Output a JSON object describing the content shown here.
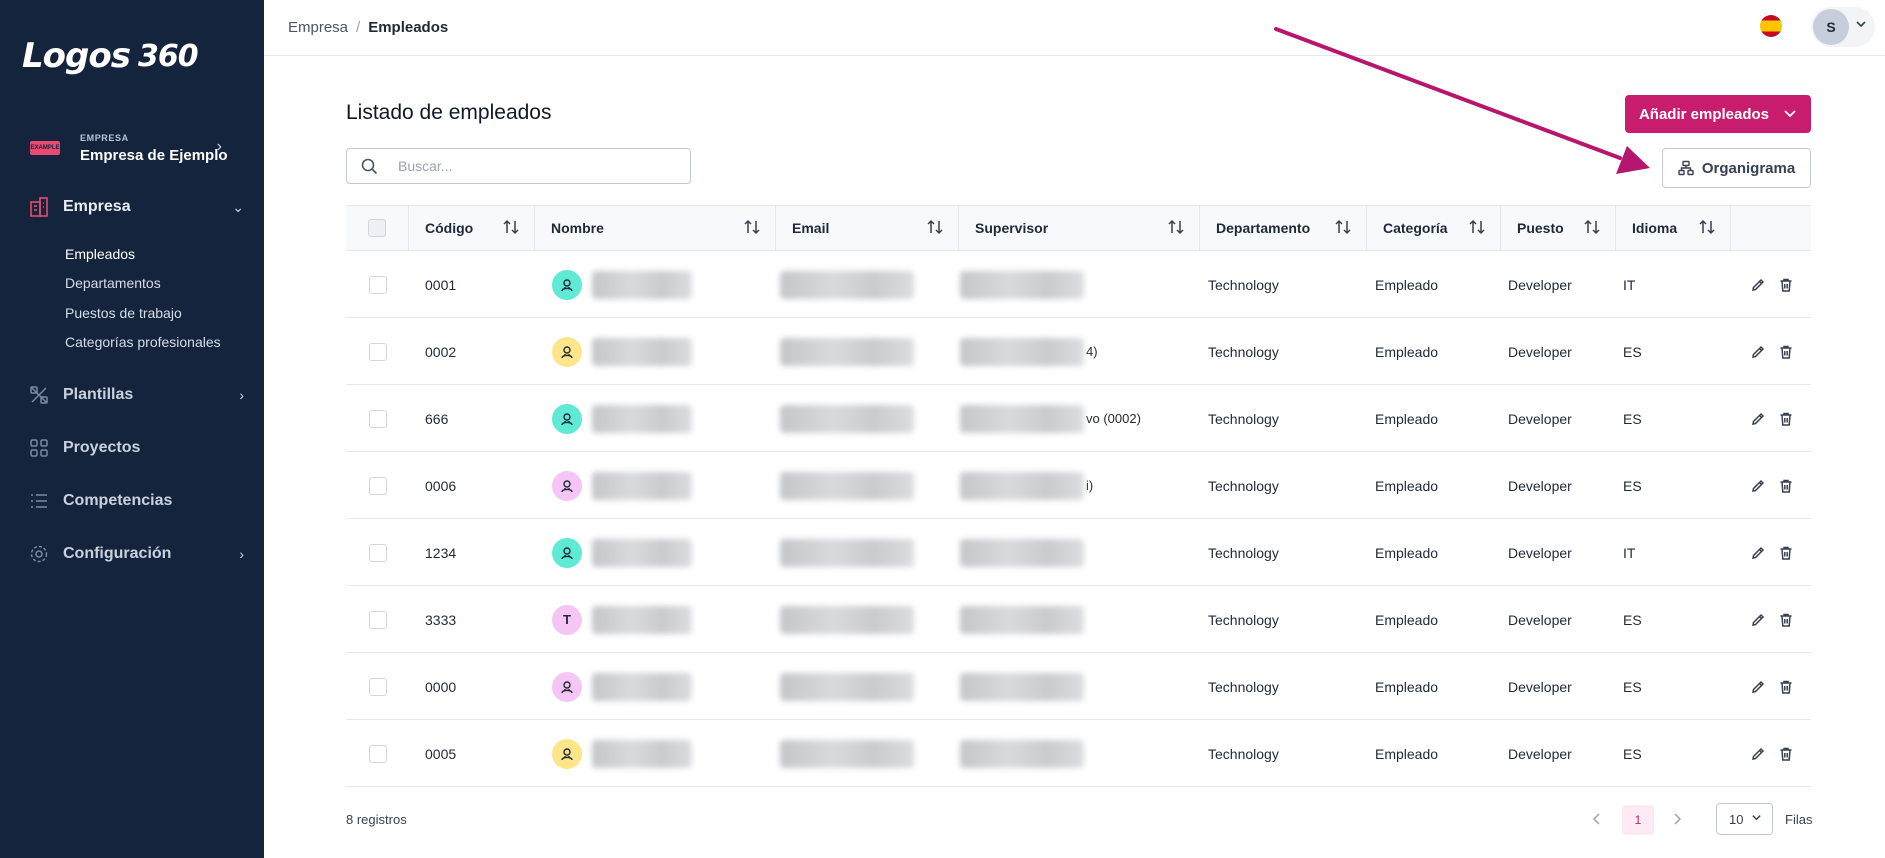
{
  "app": {
    "logo_text": "Logos",
    "logo_number": "360"
  },
  "sidebar": {
    "company_badge": "EXAMPLE",
    "company_kicker": "EMPRESA",
    "company_name": "Empresa de Ejemplo",
    "nav": [
      {
        "label": "Empresa",
        "icon": "building-icon",
        "expanded": true
      },
      {
        "label": "Plantillas",
        "icon": "template-icon"
      },
      {
        "label": "Proyectos",
        "icon": "grid-icon"
      },
      {
        "label": "Competencias",
        "icon": "list-icon"
      },
      {
        "label": "Configuración",
        "icon": "gear-icon"
      }
    ],
    "subitems": [
      "Empleados",
      "Departamentos",
      "Puestos de trabajo",
      "Categorías profesionales"
    ]
  },
  "topbar": {
    "breadcrumb": [
      "Empresa",
      "Empleados"
    ],
    "user_initial": "S",
    "language": "ES"
  },
  "main": {
    "title": "Listado de empleados",
    "add_button": "Añadir empleados",
    "org_button": "Organigrama",
    "search_placeholder": "Buscar...",
    "columns": [
      "Código",
      "Nombre",
      "Email",
      "Supervisor",
      "Departamento",
      "Categoría",
      "Puesto",
      "Idioma"
    ],
    "rows": [
      {
        "code": "0001",
        "avatar": "person",
        "avatar_color": "#5eead4",
        "sup_suffix": "",
        "department": "Technology",
        "category": "Empleado",
        "position": "Developer",
        "language": "IT"
      },
      {
        "code": "0002",
        "avatar": "person",
        "avatar_color": "#fde68a",
        "sup_suffix": "4)",
        "department": "Technology",
        "category": "Empleado",
        "position": "Developer",
        "language": "ES"
      },
      {
        "code": "666",
        "avatar": "person",
        "avatar_color": "#5eead4",
        "sup_suffix": "vo (0002)",
        "department": "Technology",
        "category": "Empleado",
        "position": "Developer",
        "language": "ES"
      },
      {
        "code": "0006",
        "avatar": "person",
        "avatar_color": "#f5c6f5",
        "sup_suffix": "i)",
        "department": "Technology",
        "category": "Empleado",
        "position": "Developer",
        "language": "ES"
      },
      {
        "code": "1234",
        "avatar": "person",
        "avatar_color": "#5eead4",
        "sup_suffix": "",
        "department": "Technology",
        "category": "Empleado",
        "position": "Developer",
        "language": "IT"
      },
      {
        "code": "3333",
        "avatar": "T",
        "avatar_color": "#f5c6f5",
        "sup_suffix": "",
        "department": "Technology",
        "category": "Empleado",
        "position": "Developer",
        "language": "ES"
      },
      {
        "code": "0000",
        "avatar": "person",
        "avatar_color": "#f5c6f5",
        "sup_suffix": "",
        "department": "Technology",
        "category": "Empleado",
        "position": "Developer",
        "language": "ES"
      },
      {
        "code": "0005",
        "avatar": "person",
        "avatar_color": "#fde68a",
        "sup_suffix": "",
        "department": "Technology",
        "category": "Empleado",
        "position": "Developer",
        "language": "ES"
      }
    ],
    "record_count": "8 registros",
    "current_page": "1",
    "rows_per_page": "10",
    "rows_label": "Filas"
  },
  "colors": {
    "accent": "#c81d6e",
    "sidebar_bg": "#15243d",
    "arrow": "#b5176f"
  }
}
